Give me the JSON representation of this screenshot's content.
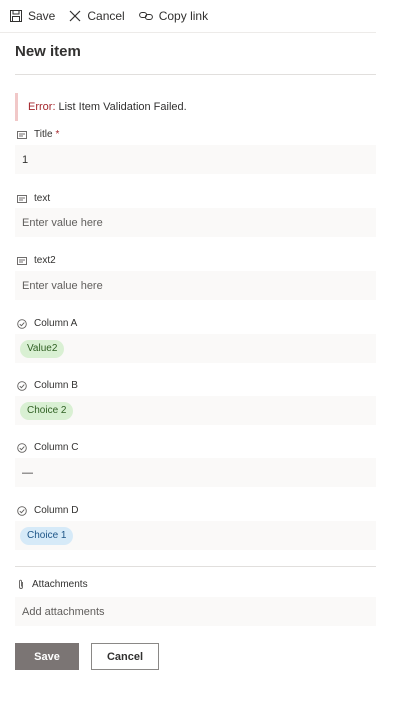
{
  "toolbar": {
    "save_label": "Save",
    "cancel_label": "Cancel",
    "copy_link_label": "Copy link"
  },
  "header": {
    "title": "New item"
  },
  "error": {
    "label": "Error:",
    "message": "List Item Validation Failed."
  },
  "fields": {
    "title": {
      "label": "Title",
      "required_mark": "*",
      "value": "1",
      "icon": "text-field-icon"
    },
    "text": {
      "label": "text",
      "placeholder": "Enter value here",
      "icon": "text-field-icon"
    },
    "text2": {
      "label": "text2",
      "placeholder": "Enter value here",
      "icon": "text-field-icon"
    },
    "column_a": {
      "label": "Column A",
      "value": "Value2",
      "icon": "choice-field-icon"
    },
    "column_b": {
      "label": "Column B",
      "value": "Choice 2",
      "icon": "choice-field-icon"
    },
    "column_c": {
      "label": "Column C",
      "value": "—",
      "icon": "choice-field-icon"
    },
    "column_d": {
      "label": "Column D",
      "value": "Choice 1",
      "icon": "choice-field-icon"
    },
    "attachments": {
      "label": "Attachments",
      "placeholder": "Add attachments",
      "icon": "paperclip-icon"
    }
  },
  "colors": {
    "pill_green_bg": "#d9f0d3",
    "pill_green_text": "#2f5f22",
    "pill_blue_bg": "#d6eaf8",
    "pill_blue_text": "#1d5587",
    "error_red": "#a4262c",
    "save_button_bg": "#7b7574"
  },
  "footer": {
    "save_label": "Save",
    "cancel_label": "Cancel"
  }
}
